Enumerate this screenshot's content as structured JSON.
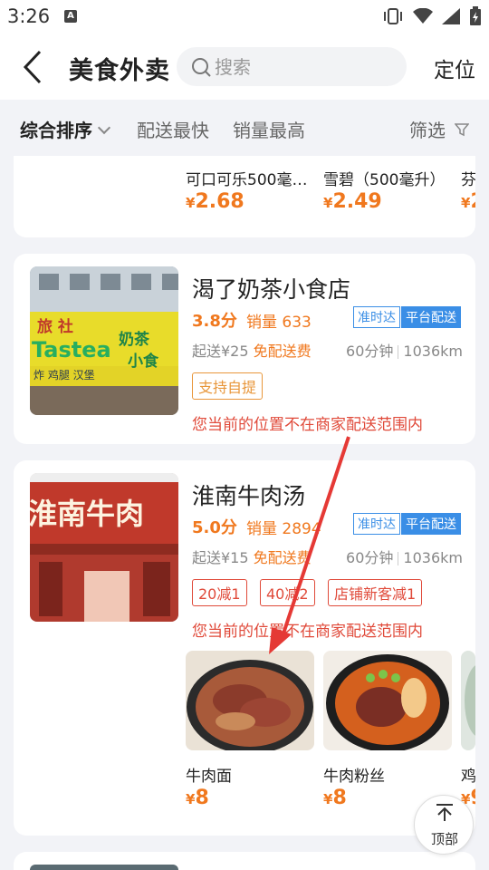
{
  "status": {
    "time": "3:26",
    "notif_glyph": "A"
  },
  "header": {
    "title": "美食外卖",
    "search_placeholder": "搜索",
    "locate_label": "定位",
    "back_icon": "chevron-left-icon"
  },
  "sort": {
    "comprehensive": "综合排序",
    "fastest": "配送最快",
    "top_sales": "销量最高",
    "filter": "筛选"
  },
  "top_card": {
    "dishes": [
      {
        "name": "可口可乐500毫…",
        "currency": "¥",
        "price": "2.68"
      },
      {
        "name": "雪碧（500毫升）",
        "currency": "¥",
        "price": "2.49"
      },
      {
        "name": "芬",
        "currency": "¥",
        "price": "2"
      }
    ]
  },
  "shops": [
    {
      "name": "渴了奶茶小食店",
      "rating": "3.8分",
      "sales": "销量 633",
      "tag_ontime": "准时达",
      "tag_platform": "平台配送",
      "min_order": "起送¥25",
      "free_delivery": "免配送费",
      "time": "60分钟",
      "distance": "1036km",
      "pickup": "支持自提",
      "notice": "您当前的位置不在商家配送范围内",
      "sign_text": "Tastea",
      "sign_text2": "奶茶",
      "sign_text3": "小食",
      "sign_sub": "炸 鸡腿 汉堡"
    },
    {
      "name": "淮南牛肉汤",
      "rating": "5.0分",
      "sales": "销量 2894",
      "tag_ontime": "准时达",
      "tag_platform": "平台配送",
      "min_order": "起送¥15",
      "free_delivery": "免配送费",
      "time": "60分钟",
      "distance": "1036km",
      "promos": [
        "20减1",
        "40减2",
        "店铺新客减1"
      ],
      "notice": "您当前的位置不在商家配送范围内",
      "sign_text": "淮南牛肉",
      "dishes": [
        {
          "name": "牛肉面",
          "currency": "¥",
          "price": "8"
        },
        {
          "name": "牛肉粉丝",
          "currency": "¥",
          "price": "8"
        },
        {
          "name": "鸡",
          "currency": "¥",
          "price": "9"
        }
      ]
    }
  ],
  "back_to_top": {
    "label": "顶部"
  },
  "colors": {
    "accent_orange": "#f0781e",
    "notice_red": "#e04a3a",
    "tag_blue": "#3a8ee6",
    "annotation_arrow": "#e53935"
  }
}
